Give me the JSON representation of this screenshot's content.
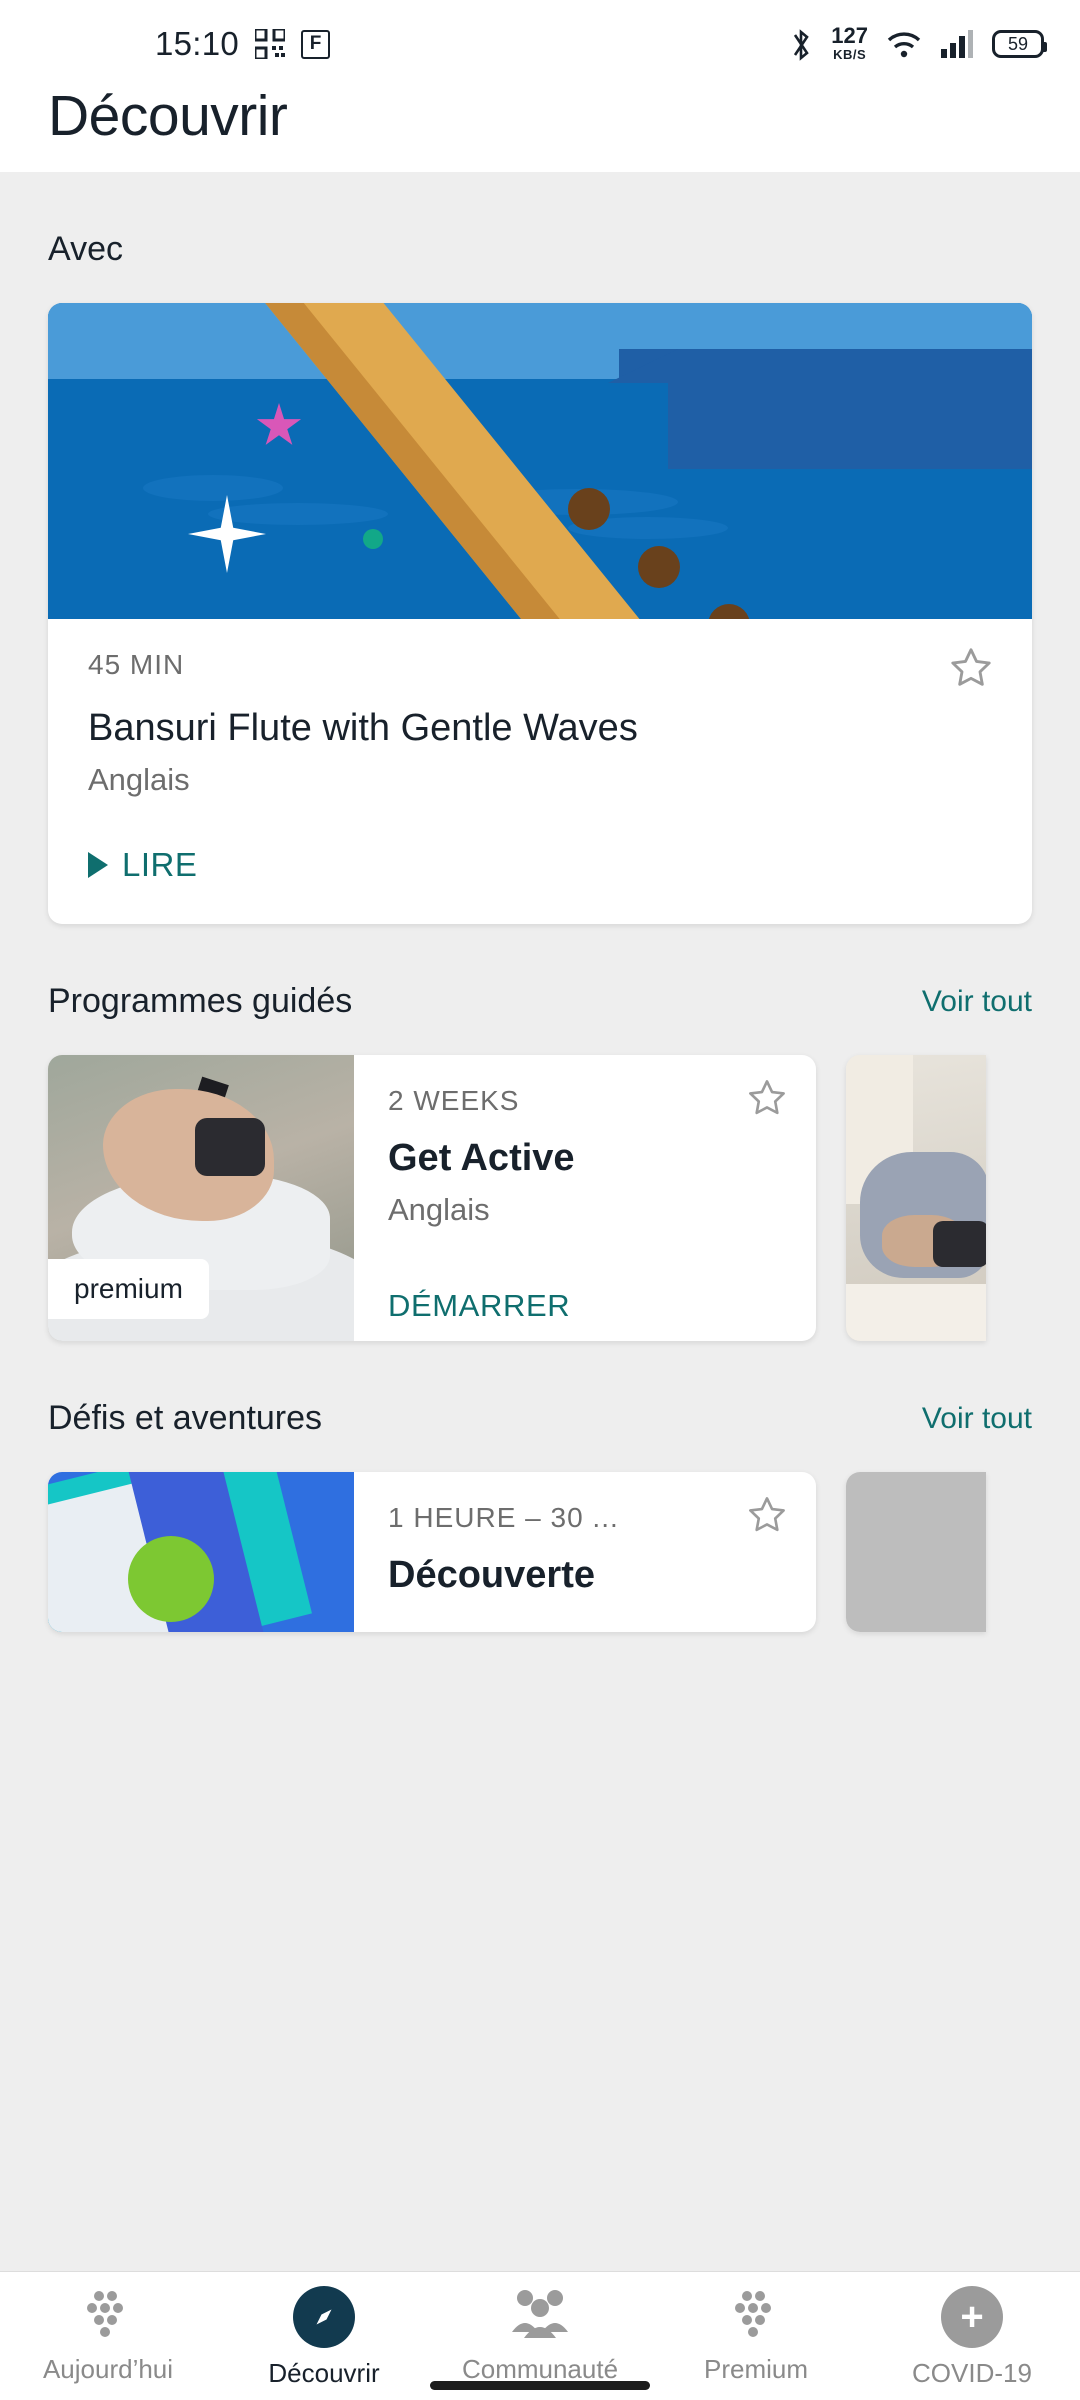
{
  "status_bar": {
    "clock": "15:10",
    "qr_icon": "qr-code-icon",
    "f_badge": "F",
    "bluetooth_icon": "bluetooth-icon",
    "net_speed_value": "127",
    "net_speed_unit": "KB/S",
    "wifi_icon": "wifi-icon",
    "signal_icon": "cellular-signal-icon",
    "battery_level": "59"
  },
  "header": {
    "title": "Découvrir"
  },
  "sections": {
    "avec": {
      "title": "Avec",
      "hero": {
        "duration": "45 MIN",
        "title": "Bansuri Flute with Gentle Waves",
        "language": "Anglais",
        "cta": "LIRE",
        "favorite_icon": "star-outline-icon",
        "play_icon": "play-triangle-icon"
      }
    },
    "programmes": {
      "title": "Programmes guidés",
      "see_all": "Voir tout",
      "cards": [
        {
          "duration": "2 WEEKS",
          "title": "Get Active",
          "language": "Anglais",
          "cta": "DÉMARRER",
          "badge": "premium",
          "favorite_icon": "star-outline-icon",
          "image": "running-shoes-watch-photo"
        },
        {
          "image": "person-sleeping-photo"
        }
      ]
    },
    "defis": {
      "title": "Défis et aventures",
      "see_all": "Voir tout",
      "cards": [
        {
          "duration": "1 HEURE – 30 ...",
          "title": "Découverte",
          "favorite_icon": "star-outline-icon",
          "image": "map-illustration"
        },
        {
          "image": "grey-placeholder"
        }
      ]
    }
  },
  "bottom_nav": {
    "items": [
      {
        "label": "Aujourd’hui",
        "icon": "dots-grid-icon",
        "active": false
      },
      {
        "label": "Découvrir",
        "icon": "compass-icon",
        "active": true
      },
      {
        "label": "Communauté",
        "icon": "people-icon",
        "active": false
      },
      {
        "label": "Premium",
        "icon": "dots-grid-icon",
        "active": false
      },
      {
        "label": "COVID-19",
        "icon": "plus-circle-icon",
        "active": false
      }
    ]
  },
  "colors": {
    "accent_teal": "#0f6e6e",
    "text_dark": "#18212b",
    "text_muted": "#6d6d6d",
    "page_bg": "#eeeeee",
    "nav_active": "#123a4f"
  }
}
